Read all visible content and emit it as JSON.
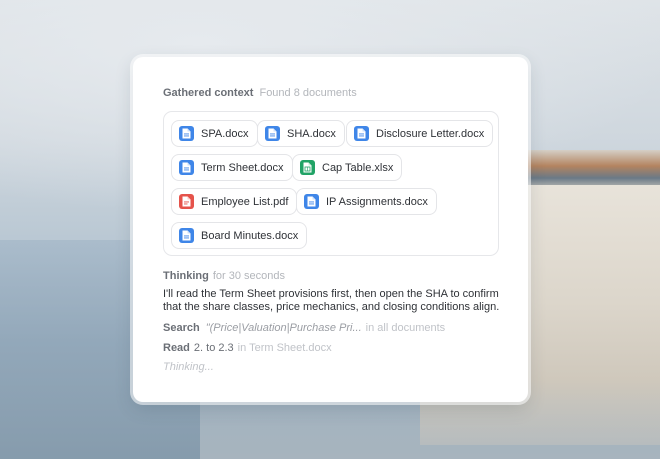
{
  "context": {
    "label": "Gathered context",
    "summary": "Found 8 documents",
    "documents": [
      {
        "name": "SPA.docx",
        "icon": "word-doc-icon"
      },
      {
        "name": "SHA.docx",
        "icon": "word-doc-icon"
      },
      {
        "name": "Disclosure Letter.docx",
        "icon": "word-doc-icon"
      },
      {
        "name": "Term Sheet.docx",
        "icon": "word-doc-icon"
      },
      {
        "name": "Cap Table.xlsx",
        "icon": "spreadsheet-icon"
      },
      {
        "name": "Employee List.pdf",
        "icon": "pdf-icon"
      },
      {
        "name": "IP Assignments.docx",
        "icon": "word-doc-icon"
      },
      {
        "name": "Board Minutes.docx",
        "icon": "word-doc-icon"
      }
    ]
  },
  "thinking": {
    "label": "Thinking",
    "duration": "for 30 seconds",
    "text": "I'll read the Term Sheet provisions first, then open the SHA to confirm that the share classes, price mechanics, and closing conditions align."
  },
  "steps": {
    "search": {
      "verb": "Search",
      "query": "\"(Price|Valuation|Purchase Pri...",
      "scope": "in all documents"
    },
    "read": {
      "verb": "Read",
      "range": "2. to 2.3",
      "source": "in Term Sheet.docx"
    }
  },
  "status": "Thinking...",
  "colors": {
    "word": "#3f86e8",
    "excel": "#21a366",
    "pdf": "#e5534b"
  }
}
